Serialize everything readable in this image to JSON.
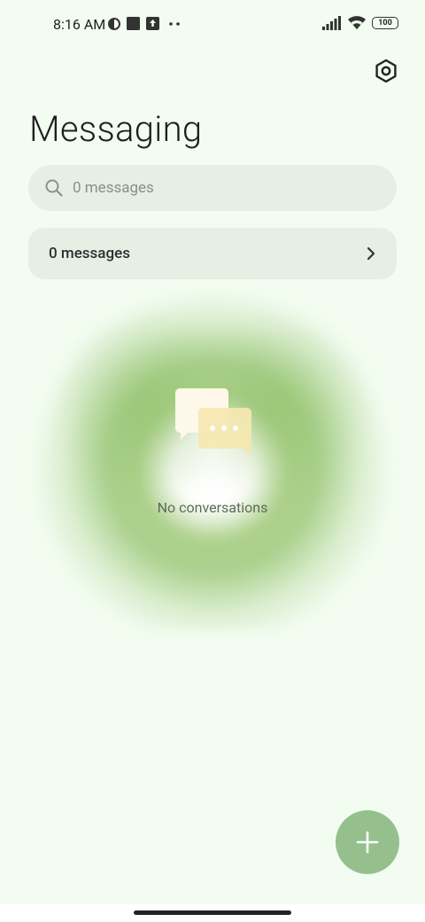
{
  "status_bar": {
    "time": "8:16 AM",
    "battery": "100"
  },
  "header": {
    "title": "Messaging"
  },
  "search": {
    "placeholder": "0 messages"
  },
  "summary": {
    "label": "0 messages"
  },
  "empty_state": {
    "text": "No conversations"
  },
  "colors": {
    "background": "#f2fcf0",
    "fab": "#95c08e",
    "card": "#e7efe5"
  },
  "icons": {
    "settings": "settings-hex-icon",
    "search": "search-icon",
    "chevron": "chevron-right-icon",
    "fab": "plus-icon",
    "empty": "chat-bubbles-icon"
  }
}
